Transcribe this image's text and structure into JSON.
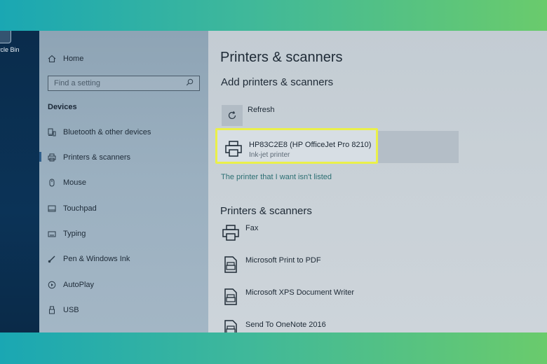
{
  "desktop": {
    "recycle_bin_label": "ycle Bin"
  },
  "sidebar": {
    "home_label": "Home",
    "search_placeholder": "Find a setting",
    "section_heading": "Devices",
    "items": [
      {
        "label": "Bluetooth & other devices",
        "icon": "bluetooth-devices-icon"
      },
      {
        "label": "Printers & scanners",
        "icon": "printer-icon",
        "selected": true
      },
      {
        "label": "Mouse",
        "icon": "mouse-icon"
      },
      {
        "label": "Touchpad",
        "icon": "touchpad-icon"
      },
      {
        "label": "Typing",
        "icon": "keyboard-icon"
      },
      {
        "label": "Pen & Windows Ink",
        "icon": "pen-icon"
      },
      {
        "label": "AutoPlay",
        "icon": "autoplay-icon"
      },
      {
        "label": "USB",
        "icon": "usb-icon"
      }
    ]
  },
  "main": {
    "page_title": "Printers & scanners",
    "add_heading": "Add printers & scanners",
    "refresh_label": "Refresh",
    "found_printer": {
      "name": "HP83C2E8 (HP OfficeJet Pro 8210)",
      "type": "Ink-jet printer"
    },
    "not_listed_link": "The printer that I want isn't listed",
    "list_heading": "Printers & scanners",
    "devices": [
      {
        "label": "Fax",
        "icon": "fax-printer-icon"
      },
      {
        "label": "Microsoft Print to PDF",
        "icon": "document-printer-icon"
      },
      {
        "label": "Microsoft XPS Document Writer",
        "icon": "document-printer-icon"
      },
      {
        "label": "Send To OneNote 2016",
        "icon": "document-printer-icon"
      }
    ]
  },
  "colors": {
    "highlight_border": "#eaf04a",
    "link": "#2c6f73",
    "sidebar_bg": "#9bb0c0",
    "main_bg": "#c9d1d7"
  }
}
